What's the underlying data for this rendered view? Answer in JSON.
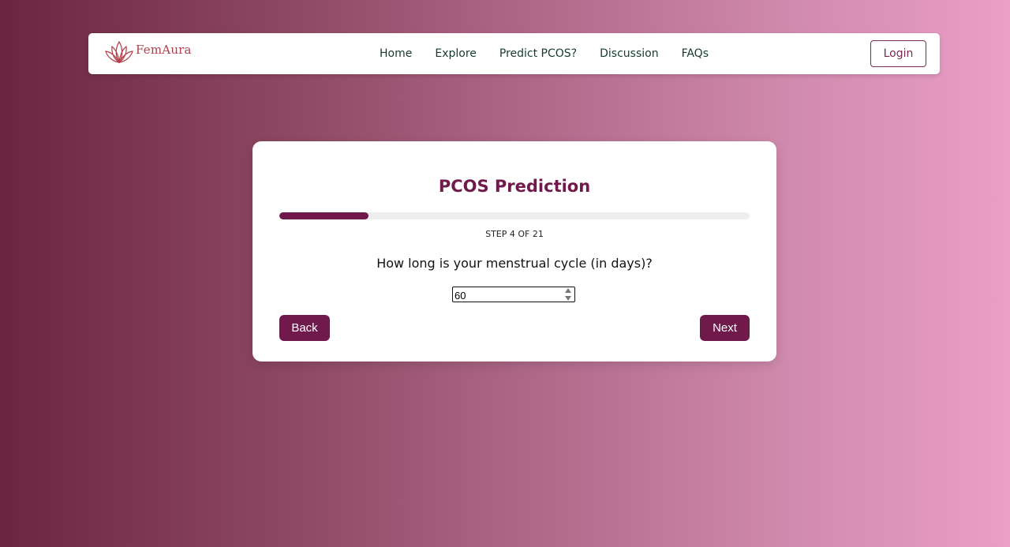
{
  "brand": {
    "name": "FemAura",
    "logo_icon": "lotus-icon",
    "logo_color": "#b13f49"
  },
  "nav": {
    "links": [
      "Home",
      "Explore",
      "Predict PCOS?",
      "Discussion",
      "FAQs"
    ],
    "login_label": "Login"
  },
  "form": {
    "title": "PCOS Prediction",
    "progress_fraction": 0.19,
    "step_label": "STEP 4 OF 21",
    "question": "How long is your menstrual cycle (in days)?",
    "answer_value": "60",
    "back_label": "Back",
    "next_label": "Next"
  },
  "colors": {
    "accent": "#701a4c",
    "gradient_start": "#6b2540",
    "gradient_end": "#ec9ec6"
  }
}
